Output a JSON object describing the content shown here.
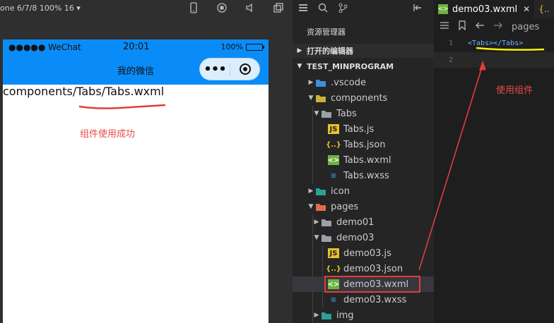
{
  "simulator": {
    "device_info": "one 6/7/8 100% 16 ▾",
    "statusbar": {
      "carrier": "●●●●● WeChat",
      "time": "20:01",
      "battery": "100%"
    },
    "nav_title": "我的微信",
    "page_text": "components/Tabs/Tabs.wxml",
    "annotation": "组件使用成功"
  },
  "explorer": {
    "title": "资源管理器",
    "open_editors": "打开的编辑器",
    "project": "TEST_MINPROGRAM",
    "items": [
      {
        "label": ".vscode",
        "icon": "vscode-folder-icon"
      },
      {
        "label": "components",
        "icon": "components-folder-icon"
      },
      {
        "label": "Tabs",
        "icon": "folder-open-icon"
      },
      {
        "label": "Tabs.js",
        "icon": "js-file-icon"
      },
      {
        "label": "Tabs.json",
        "icon": "json-file-icon"
      },
      {
        "label": "Tabs.wxml",
        "icon": "wxml-file-icon"
      },
      {
        "label": "Tabs.wxss",
        "icon": "wxss-file-icon"
      },
      {
        "label": "icon",
        "icon": "icon-folder-icon"
      },
      {
        "label": "pages",
        "icon": "pages-folder-icon"
      },
      {
        "label": "demo01",
        "icon": "folder-icon"
      },
      {
        "label": "demo03",
        "icon": "folder-open-icon"
      },
      {
        "label": "demo03.js",
        "icon": "js-file-icon"
      },
      {
        "label": "demo03.json",
        "icon": "json-file-icon"
      },
      {
        "label": "demo03.wxml",
        "icon": "wxml-file-icon"
      },
      {
        "label": "demo03.wxss",
        "icon": "wxss-file-icon"
      },
      {
        "label": "img",
        "icon": "img-folder-icon"
      }
    ]
  },
  "editor": {
    "tab_label": "demo03.wxml",
    "breadcrumb": "pages",
    "lines": [
      {
        "num": "1",
        "code": "<Tabs></Tabs>"
      },
      {
        "num": "2",
        "code": ""
      }
    ],
    "annotation": "使用组件"
  },
  "colors": {
    "nav_blue": "#0a8cf8",
    "annotation_red": "#e84a4a",
    "underline_yellow": "#f5f500"
  }
}
